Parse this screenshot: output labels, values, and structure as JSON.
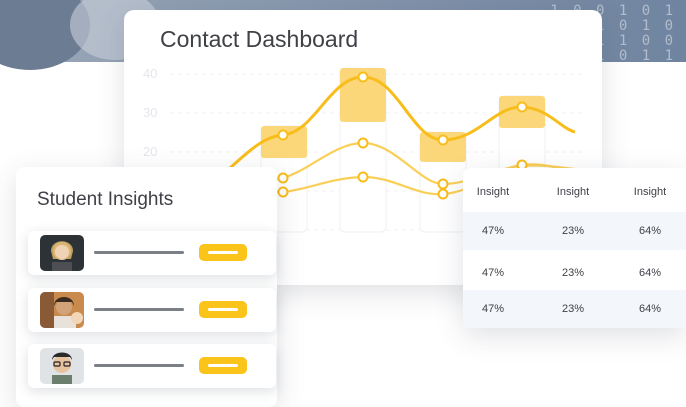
{
  "dashboard": {
    "title": "Contact Dashboard",
    "y_ticks": [
      "40",
      "30",
      "20"
    ]
  },
  "students": {
    "title": "Student Insights",
    "rows": [
      {
        "avatar": "student-avatar-1"
      },
      {
        "avatar": "student-avatar-2"
      },
      {
        "avatar": "student-avatar-3"
      }
    ]
  },
  "insights_table": {
    "headers": [
      "Insight",
      "Insight",
      "Insight"
    ],
    "rows": [
      [
        "47%",
        "23%",
        "64%"
      ],
      [
        "47%",
        "23%",
        "64%"
      ],
      [
        "47%",
        "23%",
        "64%"
      ]
    ]
  },
  "colors": {
    "accent": "#fbc41a",
    "bar_highlight": "#fbd77a",
    "curve_main": "#f8bd1a",
    "curve_light": "#f9cf57"
  }
}
